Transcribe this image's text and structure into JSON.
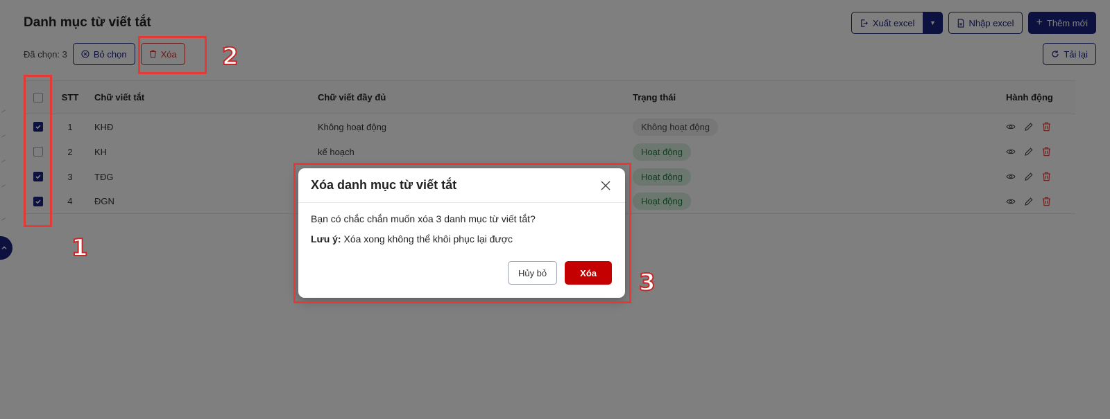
{
  "page": {
    "title": "Danh mục từ viết tắt",
    "actions": {
      "export_label": "Xuất excel",
      "import_label": "Nhập excel",
      "add_label": "Thêm mới"
    },
    "selection": {
      "count_label": "Đã chọn: 3",
      "deselect_label": "Bỏ chọn",
      "delete_label": "Xóa"
    },
    "reload_label": "Tải lại"
  },
  "table": {
    "columns": [
      "STT",
      "Chữ viết tắt",
      "Chữ viết đầy đủ",
      "Trạng thái",
      "Hành động"
    ],
    "rows": [
      {
        "checked": true,
        "stt": "1",
        "abbr": "KHĐ",
        "full": "Không hoạt động",
        "status": "Không hoạt động",
        "status_type": "inactive"
      },
      {
        "checked": false,
        "stt": "2",
        "abbr": "KH",
        "full": "kế hoạch",
        "status": "Hoạt động",
        "status_type": "active"
      },
      {
        "checked": true,
        "stt": "3",
        "abbr": "TĐG",
        "full": "",
        "status": "Hoạt động",
        "status_type": "active"
      },
      {
        "checked": true,
        "stt": "4",
        "abbr": "ĐGN",
        "full": "",
        "status": "Hoạt động",
        "status_type": "active"
      }
    ],
    "row_icons": [
      "eye-icon",
      "pencil-icon",
      "trash-icon"
    ]
  },
  "modal": {
    "title": "Xóa danh mục từ viết tắt",
    "message": "Bạn có chắc chắn muốn xóa 3 danh mục từ viết tắt?",
    "note_label": "Lưu ý:",
    "note_text": " Xóa xong không thể khôi phục lại được",
    "cancel_label": "Hủy bỏ",
    "confirm_label": "Xóa"
  },
  "annotations": {
    "step1": "1",
    "step2": "2",
    "step3": "3"
  },
  "colors": {
    "primary": "#1a237e",
    "danger": "#c40000",
    "highlight": "#e53935",
    "active_badge_bg": "#d8f0de",
    "active_badge_text": "#1e7a3c"
  }
}
